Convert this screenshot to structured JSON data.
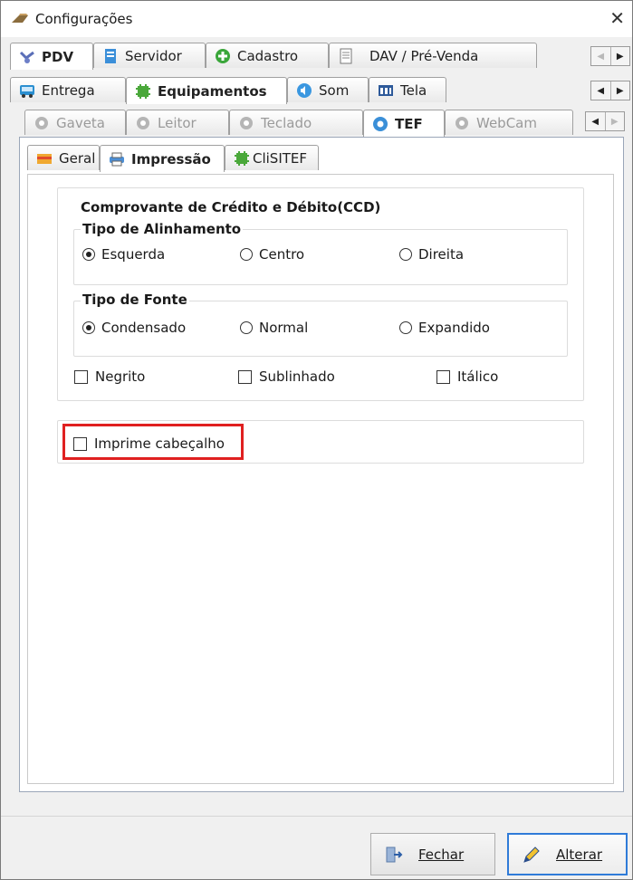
{
  "window": {
    "title": "Configurações"
  },
  "tabs_level1": [
    {
      "label": "PDV",
      "active": true
    },
    {
      "label": "Servidor"
    },
    {
      "label": "Cadastro"
    },
    {
      "label": "DAV / Pré-Venda"
    }
  ],
  "tabs_level2": [
    {
      "label": "Entrega"
    },
    {
      "label": "Equipamentos",
      "active": true
    },
    {
      "label": "Som"
    },
    {
      "label": "Tela"
    }
  ],
  "tabs_level3": [
    {
      "label": "Gaveta"
    },
    {
      "label": "Leitor"
    },
    {
      "label": "Teclado"
    },
    {
      "label": "TEF",
      "active": true
    },
    {
      "label": "WebCam"
    }
  ],
  "tabs_level4": [
    {
      "label": "Geral"
    },
    {
      "label": "Impressão",
      "active": true
    },
    {
      "label": "CliSITEF"
    }
  ],
  "ccd": {
    "title": "Comprovante de Crédito e Débito(CCD)",
    "alignment": {
      "title": "Tipo de Alinhamento",
      "options": [
        "Esquerda",
        "Centro",
        "Direita"
      ],
      "selected": "Esquerda"
    },
    "font": {
      "title": "Tipo de Fonte",
      "options": [
        "Condensado",
        "Normal",
        "Expandido"
      ],
      "selected": "Condensado"
    },
    "styles": [
      "Negrito",
      "Sublinhado",
      "Itálico"
    ]
  },
  "print_header_label": "Imprime cabeçalho",
  "buttons": {
    "close": "Fechar",
    "change": "Alterar"
  },
  "colors": {
    "highlight": "#e02020",
    "primary_border": "#2f7bd8"
  }
}
